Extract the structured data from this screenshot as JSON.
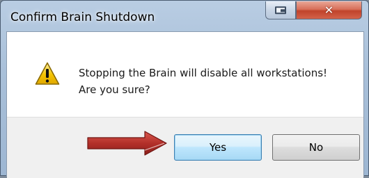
{
  "window": {
    "title": "Confirm Brain Shutdown",
    "close_glyph": "✕",
    "icons": [
      "restore-icon",
      "close-icon"
    ]
  },
  "dialog": {
    "icon": "warning-icon",
    "message_line1": "Stopping the Brain will disable all workstations!",
    "message_line2": "Are you sure?"
  },
  "buttons": {
    "yes_label": "Yes",
    "no_label": "No"
  },
  "annotation": {
    "icon": "red-arrow-icon",
    "color": "#b3302a"
  },
  "colors": {
    "close_button": "#c0432b",
    "default_button_border": "#3c7fb1",
    "warning_yellow": "#f5c400"
  }
}
